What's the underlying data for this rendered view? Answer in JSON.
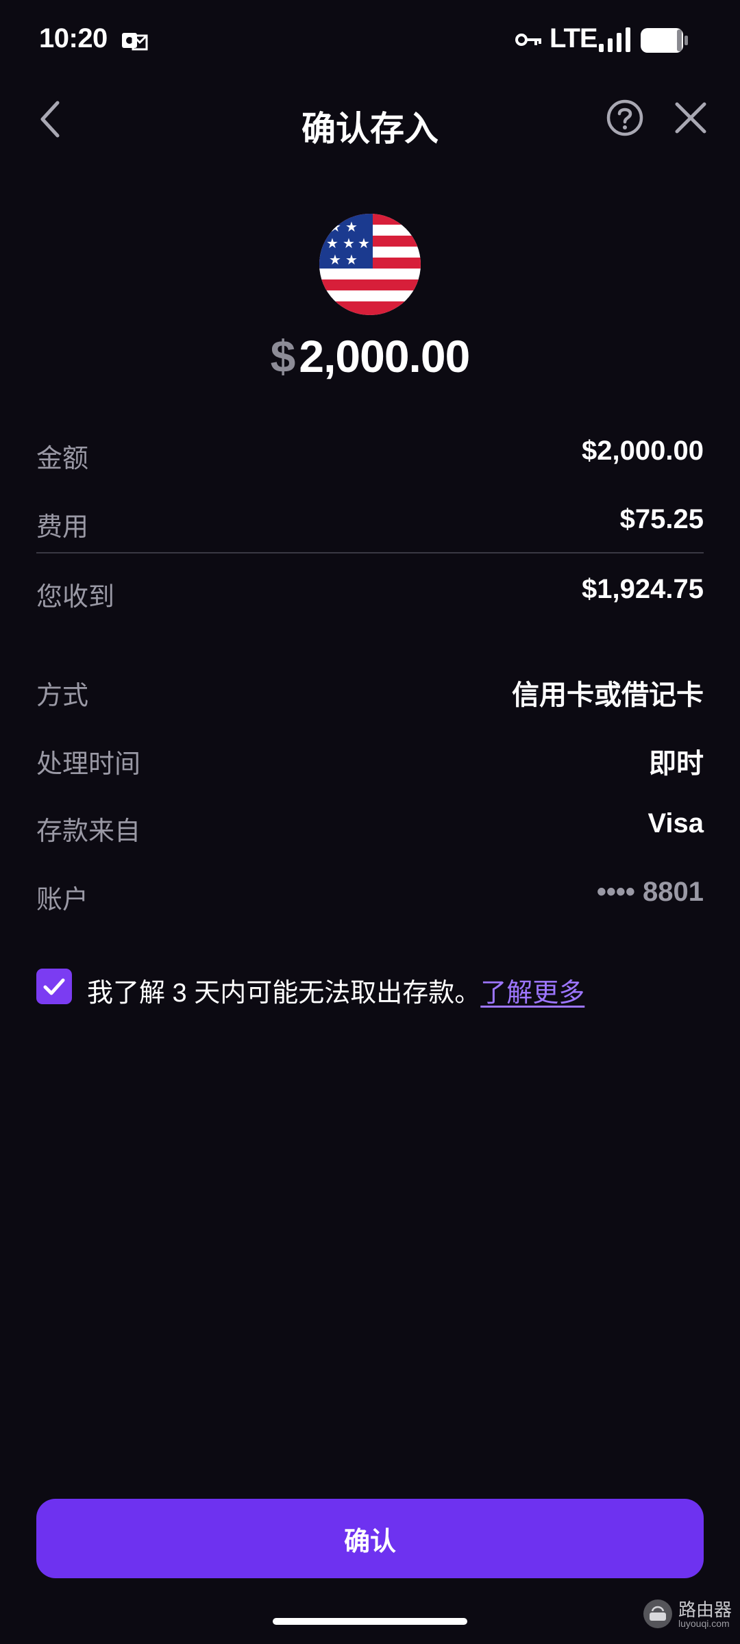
{
  "status_bar": {
    "time": "10:20",
    "network": "LTE",
    "icons": [
      "notification-icon",
      "vpn-key-icon",
      "signal-icon",
      "battery-icon"
    ]
  },
  "header": {
    "title": "确认存入",
    "icons": [
      "chevron-left-icon",
      "help-circle-icon",
      "close-icon"
    ]
  },
  "hero": {
    "flag_icon": "us-flag-icon",
    "currency_symbol": "$",
    "amount": "2,000.00"
  },
  "summary": [
    {
      "label": "金额",
      "value": "$2,000.00"
    },
    {
      "label": "费用",
      "value": "$75.25"
    },
    {
      "label": "您收到",
      "value": "$1,924.75"
    }
  ],
  "details": [
    {
      "label": "方式",
      "value": "信用卡或借记卡"
    },
    {
      "label": "处理时间",
      "value": "即时"
    },
    {
      "label": "存款来自",
      "value": "Visa"
    },
    {
      "label": "账户",
      "value": "•••• 8801"
    }
  ],
  "agreement": {
    "checked": true,
    "text": "我了解 3 天内可能无法取出存款。",
    "link": "了解更多"
  },
  "confirm_label": "确认",
  "watermark": {
    "name": "路由器",
    "url": "luyouqi.com"
  },
  "colors": {
    "background": "#0c0a12",
    "accent": "#6e32f0",
    "checkbox": "#7b3cf2",
    "link": "#9d76ff",
    "muted_text": "#9a99a5"
  }
}
